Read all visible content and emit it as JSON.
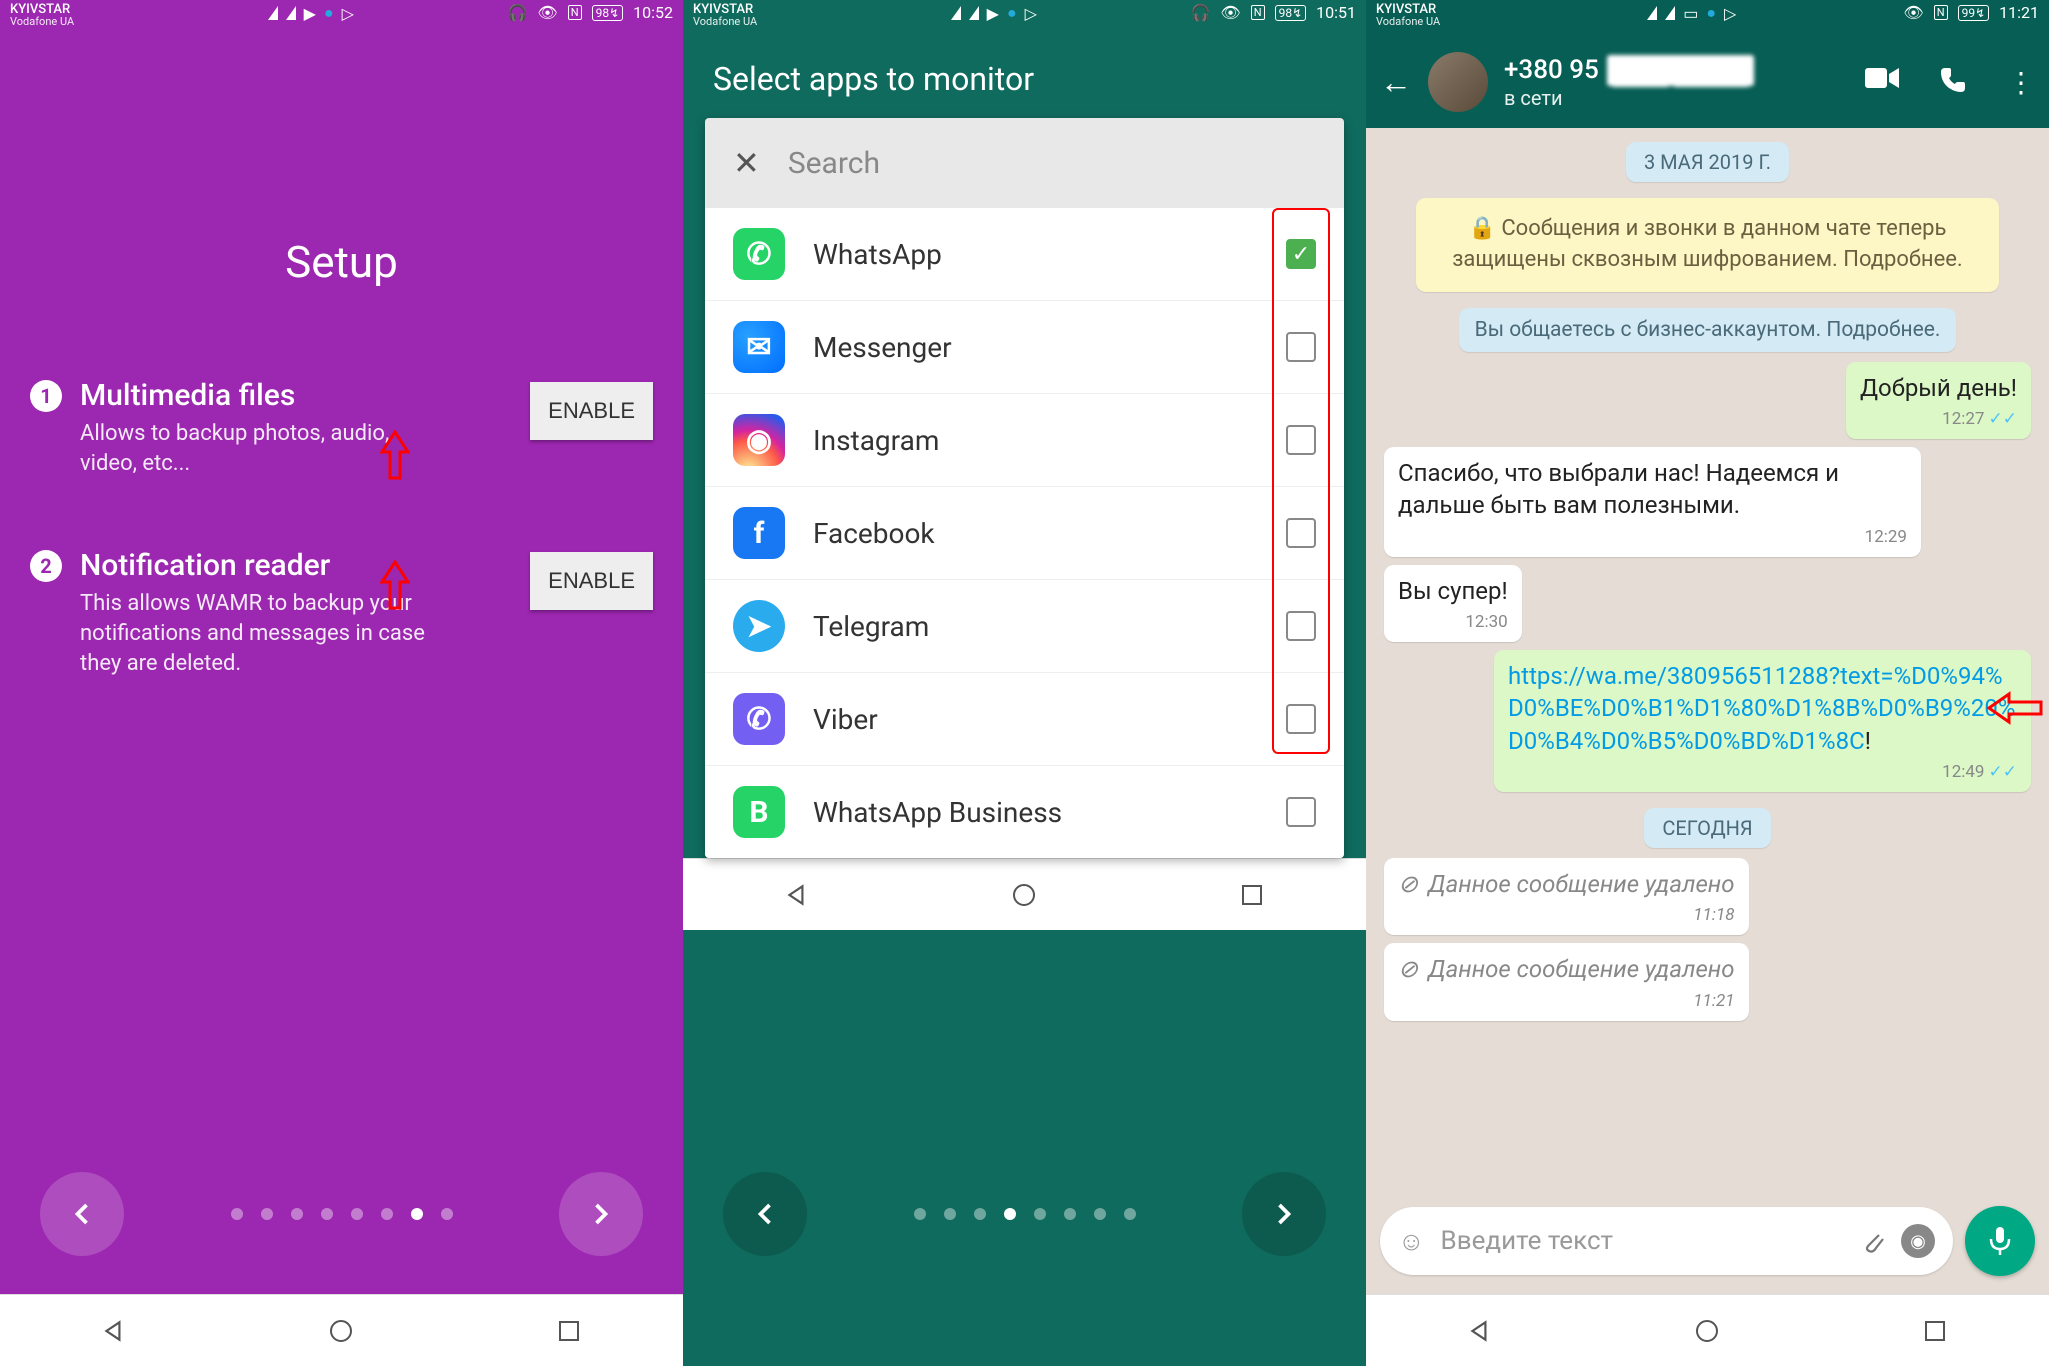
{
  "status": {
    "carrier1": "KYIVSTAR",
    "carrier2": "Vodafone UA",
    "battery1": "98",
    "battery2": "98",
    "battery3": "99",
    "time1": "10:52",
    "time2": "10:51",
    "time3": "11:21"
  },
  "s1": {
    "title": "Setup",
    "items": [
      {
        "num": "1",
        "heading": "Multimedia files",
        "desc": "Allows to backup photos, audio, video, etc...",
        "btn": "ENABLE"
      },
      {
        "num": "2",
        "heading": "Notification reader",
        "desc": "This allows WAMR to backup your notifications and messages in case they are deleted.",
        "btn": "ENABLE"
      }
    ],
    "page_count": 8,
    "active_dot": 6
  },
  "s2": {
    "header": "Select apps to monitor",
    "search_placeholder": "Search",
    "apps": [
      {
        "name": "WhatsApp",
        "checked": true,
        "icon_class": "ic-wa",
        "icon_glyph": "✆"
      },
      {
        "name": "Messenger",
        "checked": false,
        "icon_class": "ic-msg",
        "icon_glyph": "✉"
      },
      {
        "name": "Instagram",
        "checked": false,
        "icon_class": "ic-ig",
        "icon_glyph": "◉"
      },
      {
        "name": "Facebook",
        "checked": false,
        "icon_class": "ic-fb",
        "icon_glyph": "f"
      },
      {
        "name": "Telegram",
        "checked": false,
        "icon_class": "ic-tg",
        "icon_glyph": "➤"
      },
      {
        "name": "Viber",
        "checked": false,
        "icon_class": "ic-vb",
        "icon_glyph": "✆"
      },
      {
        "name": "WhatsApp Business",
        "checked": false,
        "icon_class": "ic-wab",
        "icon_glyph": "B"
      }
    ],
    "page_count": 8,
    "active_dot": 3
  },
  "s3": {
    "phone_prefix": "+380 95",
    "status": "в сети",
    "date_pill": "3 МАЯ 2019 Г.",
    "encryption_notice": "🔒 Сообщения и звонки в данном чате теперь защищены сквозным шифрованием. Подробнее.",
    "business_notice": "Вы общаетесь с бизнес-аккаунтом. Подробнее.",
    "today_pill": "СЕГОДНЯ",
    "messages": [
      {
        "dir": "out",
        "text": "Добрый день!",
        "time": "12:27",
        "ticks": true
      },
      {
        "dir": "in",
        "text": "Спасибо, что выбрали нас! Надеемся и дальше быть вам полезными.",
        "time": "12:29"
      },
      {
        "dir": "in",
        "text": "Вы супер!",
        "time": "12:30"
      },
      {
        "dir": "out",
        "link": "https://wa.me/380956511288?text=%D0%94%D0%BE%D0%B1%D1%80%D1%8B%D0%B9%20%D0%B4%D0%B5%D0%BD%D1%8C",
        "suffix": "!",
        "time": "12:49",
        "ticks": true
      },
      {
        "dir": "in",
        "deleted": true,
        "text": "Данное сообщение удалено",
        "time": "11:18"
      },
      {
        "dir": "in",
        "deleted": true,
        "text": "Данное сообщение удалено",
        "time": "11:21"
      }
    ],
    "input_placeholder": "Введите текст"
  }
}
